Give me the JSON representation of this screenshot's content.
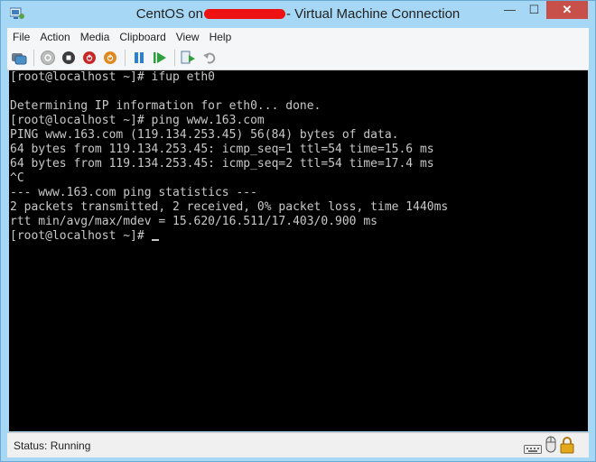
{
  "window": {
    "title_prefix": "CentOS on",
    "title_suffix": "- Virtual Machine Connection",
    "caption": {
      "minimize": "—",
      "maximize": "☐",
      "close": "✕"
    }
  },
  "menu": [
    "File",
    "Action",
    "Media",
    "Clipboard",
    "View",
    "Help"
  ],
  "toolbar": {
    "icons": [
      "ctrl-alt-del-icon",
      "start-icon",
      "turn-off-icon",
      "shutdown-icon",
      "save-icon",
      "pause-icon",
      "reset-icon",
      "checkpoint-icon",
      "revert-icon"
    ]
  },
  "console": {
    "lines": [
      "[root@localhost ~]# ifup eth0",
      "",
      "Determining IP information for eth0... done.",
      "[root@localhost ~]# ping www.163.com",
      "PING www.163.com (119.134.253.45) 56(84) bytes of data.",
      "64 bytes from 119.134.253.45: icmp_seq=1 ttl=54 time=15.6 ms",
      "64 bytes from 119.134.253.45: icmp_seq=2 ttl=54 time=17.4 ms",
      "^C",
      "--- www.163.com ping statistics ---",
      "2 packets transmitted, 2 received, 0% packet loss, time 1440ms",
      "rtt min/avg/max/mdev = 15.620/16.511/17.403/0.900 ms",
      "[root@localhost ~]#"
    ]
  },
  "status": {
    "text": "Status: Running",
    "icons": [
      "keyboard-icon",
      "mouse-icon",
      "lock-icon"
    ]
  },
  "colors": {
    "frame": "#a6d8f6",
    "console_bg": "#000000",
    "console_text": "#c8c8c8",
    "close_button": "#c7504b",
    "redaction": "#ee1111"
  }
}
